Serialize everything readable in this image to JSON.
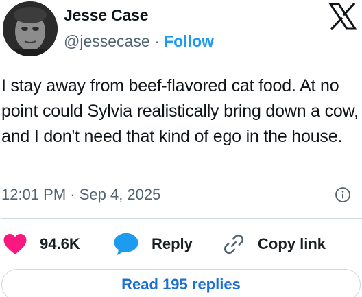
{
  "author": {
    "display_name": "Jesse Case",
    "handle": "@jessecase",
    "separator": "·",
    "follow_label": "Follow"
  },
  "tweet": {
    "text": "I stay away from beef-flavored cat food. At no point could Sylvia realistically bring down a cow, and I don't need that kind of ego in the house.",
    "timestamp": "12:01 PM · Sep 4, 2025"
  },
  "actions": {
    "likes": "94.6K",
    "reply_label": "Reply",
    "copy_label": "Copy link"
  },
  "replies_button": "Read 195 replies",
  "colors": {
    "accent": "#1d9bf0",
    "heart": "#f91880",
    "reply_bubble": "#1d9bf0",
    "secondary_text": "#536471"
  },
  "icons": [
    "x-logo-icon",
    "info-icon",
    "heart-icon",
    "reply-bubble-icon",
    "link-icon"
  ]
}
